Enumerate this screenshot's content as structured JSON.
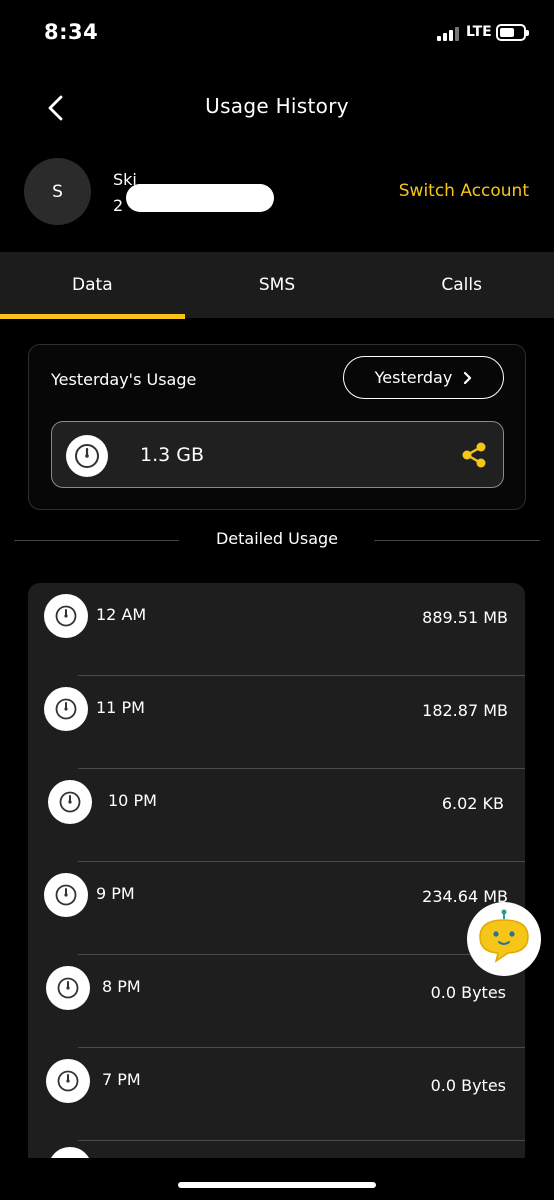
{
  "status": {
    "time": "8:34",
    "network": "LTE",
    "battery_fraction": 0.55
  },
  "header": {
    "title": "Usage History"
  },
  "account": {
    "initial": "S",
    "name": "Ski",
    "number": "2",
    "switch_label": "Switch Account"
  },
  "tabs": [
    {
      "label": "Data",
      "active": true
    },
    {
      "label": "SMS",
      "active": false
    },
    {
      "label": "Calls",
      "active": false
    }
  ],
  "summary": {
    "label": "Yesterday's Usage",
    "period": "Yesterday",
    "total": "1.3 GB"
  },
  "detailed": {
    "title": "Detailed Usage",
    "rows": [
      {
        "hour": "12 AM",
        "amount": "889.51 MB"
      },
      {
        "hour": "11 PM",
        "amount": "182.87 MB"
      },
      {
        "hour": "10 PM",
        "amount": "6.02 KB"
      },
      {
        "hour": "9 PM",
        "amount": "234.64 MB"
      },
      {
        "hour": "8 PM",
        "amount": "0.0 Bytes"
      },
      {
        "hour": "7 PM",
        "amount": "0.0 Bytes"
      }
    ]
  },
  "icons": {
    "back": "chevron-left-icon",
    "share": "share-icon",
    "gauge": "gauge-icon",
    "bot": "chat-bot-icon"
  },
  "colors": {
    "accent": "#f5c518",
    "background": "#000000",
    "card": "#1e1e1e"
  }
}
